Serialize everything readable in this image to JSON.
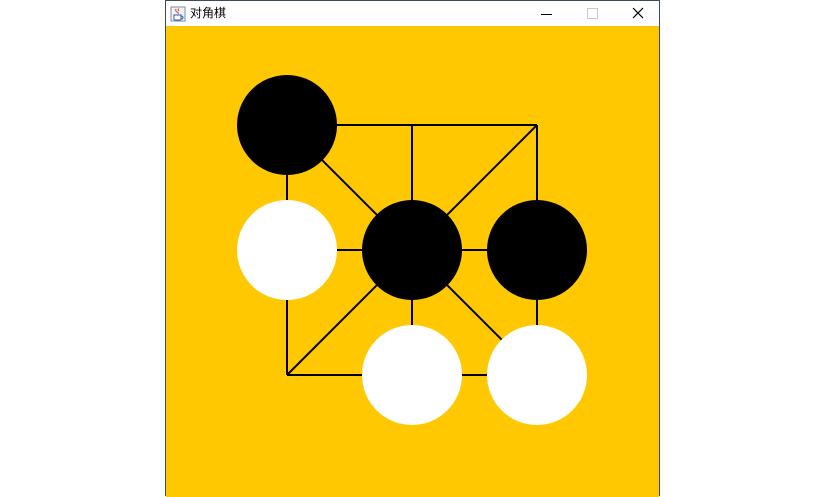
{
  "window": {
    "title": "对角棋",
    "icon": "java-coffee-cup-icon",
    "controls": {
      "minimize_icon": "minimize-icon",
      "maximize_icon": "maximize-icon",
      "close_icon": "close-icon"
    }
  },
  "board": {
    "background_color": "#ffc800",
    "line_color": "#000000",
    "grid": {
      "rows": 3,
      "cols": 3,
      "points": [
        [
          0,
          0
        ],
        [
          0,
          1
        ],
        [
          0,
          2
        ],
        [
          1,
          0
        ],
        [
          1,
          1
        ],
        [
          1,
          2
        ],
        [
          2,
          0
        ],
        [
          2,
          1
        ],
        [
          2,
          2
        ]
      ],
      "edges": [
        [
          [
            0,
            0
          ],
          [
            0,
            1
          ]
        ],
        [
          [
            0,
            1
          ],
          [
            0,
            2
          ]
        ],
        [
          [
            1,
            0
          ],
          [
            1,
            1
          ]
        ],
        [
          [
            1,
            1
          ],
          [
            1,
            2
          ]
        ],
        [
          [
            2,
            0
          ],
          [
            2,
            1
          ]
        ],
        [
          [
            2,
            1
          ],
          [
            2,
            2
          ]
        ],
        [
          [
            0,
            0
          ],
          [
            1,
            0
          ]
        ],
        [
          [
            1,
            0
          ],
          [
            2,
            0
          ]
        ],
        [
          [
            0,
            1
          ],
          [
            1,
            1
          ]
        ],
        [
          [
            1,
            1
          ],
          [
            2,
            1
          ]
        ],
        [
          [
            0,
            2
          ],
          [
            1,
            2
          ]
        ],
        [
          [
            1,
            2
          ],
          [
            2,
            2
          ]
        ],
        [
          [
            0,
            0
          ],
          [
            2,
            2
          ]
        ],
        [
          [
            0,
            2
          ],
          [
            2,
            0
          ]
        ]
      ]
    },
    "pieces": [
      {
        "row": 0,
        "col": 0,
        "color": "black"
      },
      {
        "row": 1,
        "col": 0,
        "color": "white"
      },
      {
        "row": 1,
        "col": 1,
        "color": "black"
      },
      {
        "row": 1,
        "col": 2,
        "color": "black"
      },
      {
        "row": 2,
        "col": 1,
        "color": "white"
      },
      {
        "row": 2,
        "col": 2,
        "color": "white"
      }
    ],
    "piece_colors": {
      "black": "#000000",
      "white": "#ffffff"
    }
  }
}
